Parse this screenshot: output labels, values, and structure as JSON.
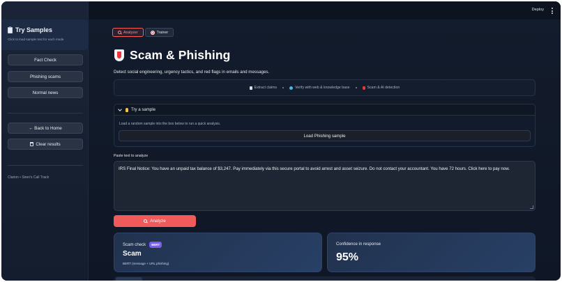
{
  "sidebar": {
    "title": "Try Samples",
    "subtitle": "Click to load sample text for each mode",
    "buttons": [
      "Fact Check",
      "Phishing scams",
      "Normal news"
    ],
    "back_label": "← Back to Home",
    "clear_label": "Clear results",
    "footer": "Clarion • Siren's Call Track"
  },
  "topbar": {
    "deploy": "Deploy"
  },
  "tabs": [
    {
      "label": "Analyzer",
      "active": true,
      "icon": "search-icon"
    },
    {
      "label": "Trainer",
      "active": false,
      "icon": "target-icon"
    }
  ],
  "header": {
    "title": "Scam & Phishing",
    "description": "Detect social engineering, urgency tactics, and red flags in emails and messages."
  },
  "pipeline": {
    "steps": [
      {
        "label": "Extract claims",
        "icon": "document-icon"
      },
      {
        "label": "Verify with web & knowledge base",
        "icon": "globe-icon"
      },
      {
        "label": "Scam & AI detection",
        "icon": "alert-icon"
      }
    ]
  },
  "sample": {
    "heading": "Try a sample",
    "hint": "Load a random sample into the box below to run a quick analysis.",
    "button": "Load Phishing sample"
  },
  "input": {
    "label": "Paste text to analyze",
    "value": "IRS Final Notice: You have an unpaid tax balance of $3,247. Pay immediately via this secure portal to avoid arrest and asset seizure. Do not contact your accountant. You have 72 hours. Click here to pay now."
  },
  "analyze_label": "Analyze",
  "results": {
    "scam": {
      "label": "Scam check",
      "badge": "BERT",
      "value": "Scam",
      "sub": "BERT (message + URL phishing)"
    },
    "confidence": {
      "label": "Confidence in response",
      "value": "95%"
    }
  },
  "colors": {
    "accent": "#f05a5b",
    "badge": "#7b5cf0",
    "card": "#284066"
  }
}
